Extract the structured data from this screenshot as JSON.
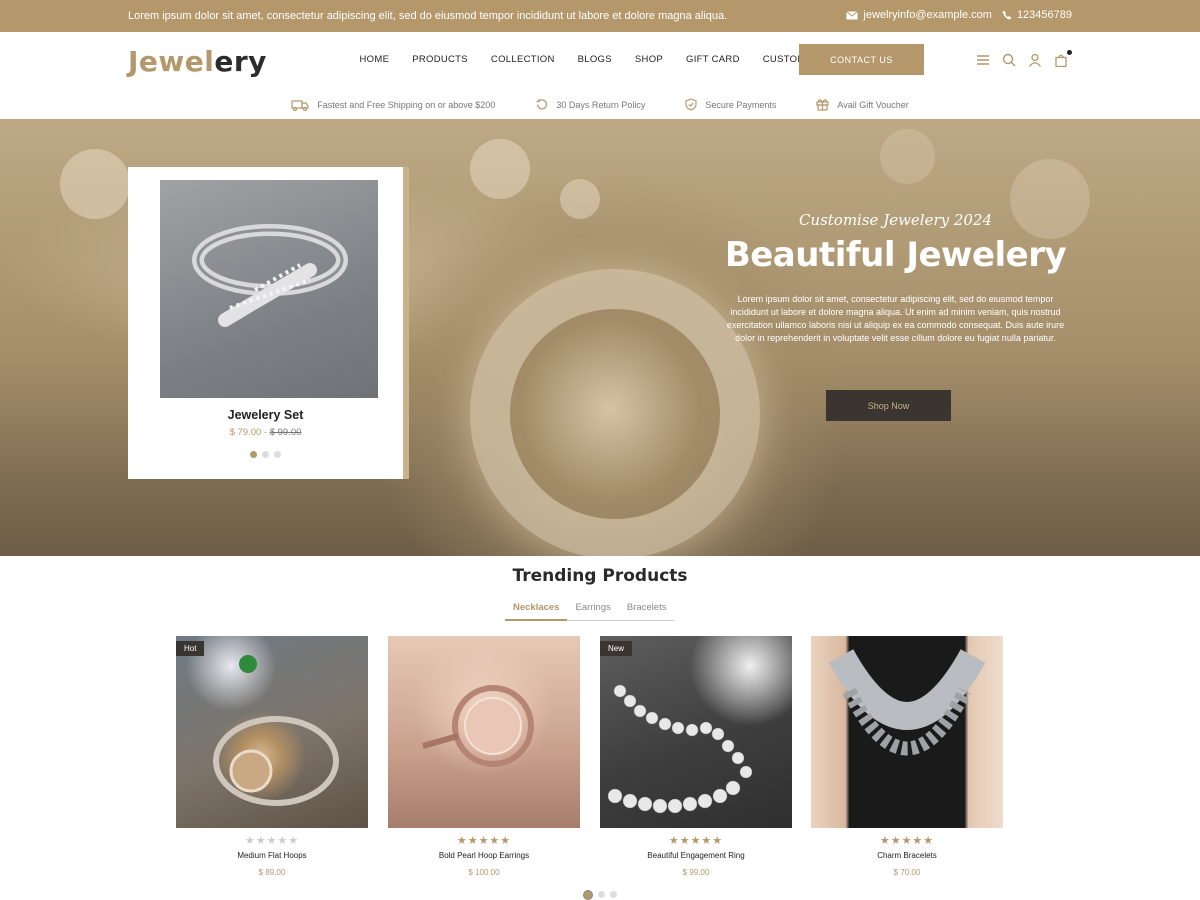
{
  "topbar": {
    "message": "Lorem ipsum dolor sit amet, consectetur adipiscing elit, sed do eiusmod tempor incididunt ut labore et dolore magna aliqua.",
    "email": "jewelryinfo@example.com",
    "phone": "123456789"
  },
  "header": {
    "logo_part1": "Jewel",
    "logo_part2": "ery",
    "nav": [
      "HOME",
      "PRODUCTS",
      "COLLECTION",
      "BLOGS",
      "SHOP",
      "GIFT CARD",
      "CUSTOMISE"
    ],
    "contact_label": "CONTACT US"
  },
  "features": [
    {
      "icon": "truck-icon",
      "text": "Fastest and Free Shipping on or above $200"
    },
    {
      "icon": "return-icon",
      "text": "30 Days Return Policy"
    },
    {
      "icon": "shield-icon",
      "text": "Secure Payments"
    },
    {
      "icon": "gift-icon",
      "text": "Avail Gift Voucher"
    }
  ],
  "hero": {
    "card_title": "Jewelery Set",
    "card_price": "$ 79.00",
    "card_old_price": "$ 99.00",
    "subtitle": "Customise Jewelery 2024",
    "title": "Beautiful Jewelery",
    "description": "Lorem ipsum dolor sit amet, consectetur adipiscing elit, sed do eiusmod tempor incididunt ut labore et dolore magna aliqua. Ut enim ad minim veniam, quis nostrud exercitation ullamco laboris nisi ut aliquip ex ea commodo consequat. Duis aute irure dolor in reprehenderit in voluptate velit esse cillum dolore eu fugiat nulla pariatur.",
    "button": "Shop Now"
  },
  "trending": {
    "title": "Trending Products",
    "tabs": [
      "Necklaces",
      "Earrings",
      "Bracelets"
    ],
    "products": [
      {
        "name": "Medium Flat Hoops",
        "price": "$ 89.00",
        "badge": "Hot",
        "rating": 0
      },
      {
        "name": "Bold Pearl Hoop Earrings",
        "price": "$ 100.00",
        "badge": "",
        "rating": 5
      },
      {
        "name": "Beautiful Engagement Ring",
        "price": "$ 99.00",
        "badge": "New",
        "rating": 5
      },
      {
        "name": "Charm Bracelets",
        "price": "$ 70.00",
        "badge": "",
        "rating": 5
      }
    ]
  },
  "colors": {
    "accent": "#b4976a",
    "dark": "#3a3530"
  }
}
